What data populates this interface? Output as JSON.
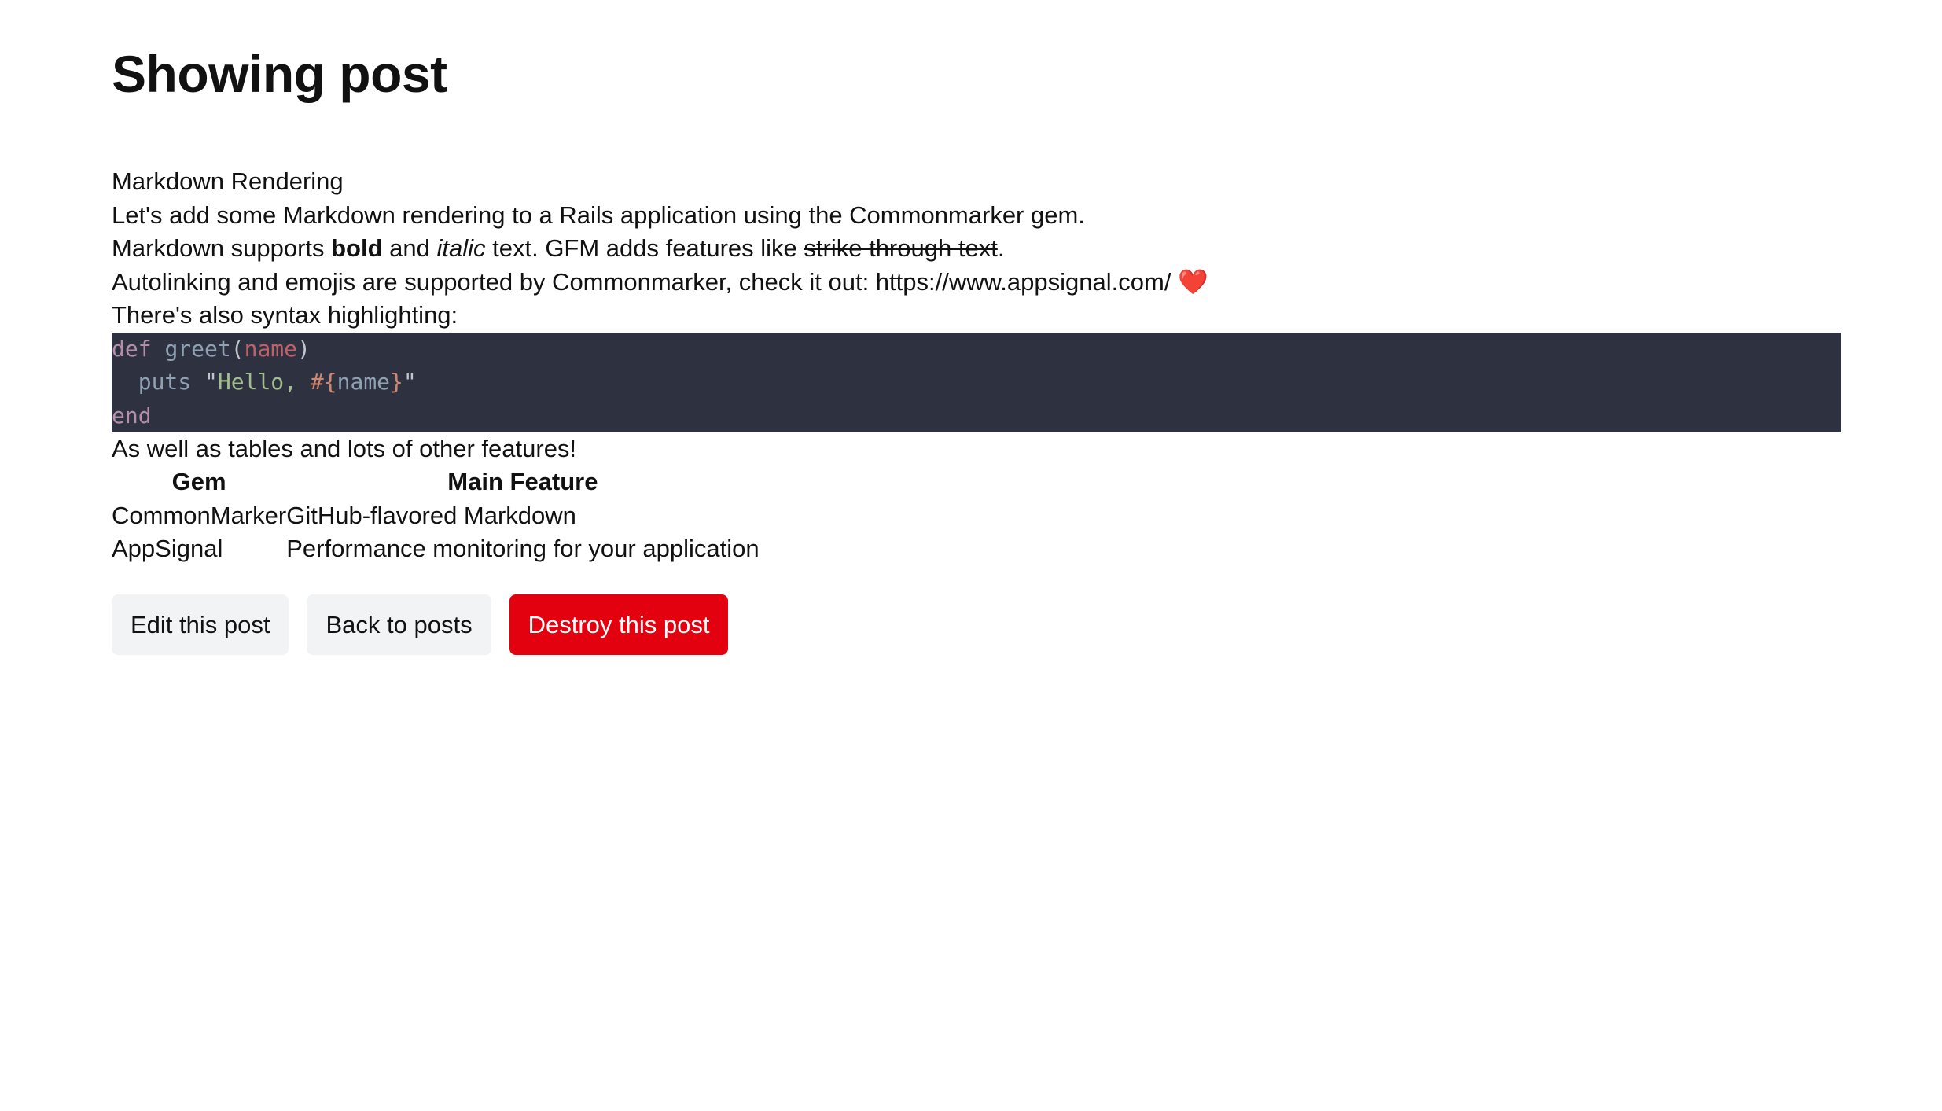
{
  "page": {
    "title": "Showing post"
  },
  "post": {
    "heading": "Markdown Rendering",
    "intro": "Let's add some Markdown rendering to a Rails application using the Commonmarker gem.",
    "line2": {
      "prefix": "Markdown supports ",
      "bold": "bold",
      "mid": " and ",
      "italic": "italic",
      "after": " text. GFM adds features like ",
      "strike": "strike through text",
      "end": "."
    },
    "line3": {
      "text": "Autolinking and emojis are supported by Commonmarker, check it out: https://www.appsignal.com/ ",
      "emoji": "❤️"
    },
    "line4": "There's also syntax highlighting:",
    "code": {
      "line1": {
        "kw": "def",
        "fn": "greet",
        "open": "(",
        "arg": "name",
        "close": ")"
      },
      "line2": {
        "indent": "  ",
        "fn": "puts",
        "q1": "\"",
        "str": "Hello, ",
        "itp_open": "#{",
        "var": "name",
        "itp_close": "}",
        "q2": "\""
      },
      "line3": {
        "kw": "end"
      }
    },
    "line5": "As well as tables and lots of other features!",
    "table": {
      "headers": [
        "Gem",
        "Main Feature"
      ],
      "rows": [
        [
          "CommonMarker",
          "GitHub-flavored Markdown"
        ],
        [
          "AppSignal",
          "Performance monitoring for your application"
        ]
      ]
    }
  },
  "actions": {
    "edit": "Edit this post",
    "back": "Back to posts",
    "destroy": "Destroy this post"
  },
  "colors": {
    "destroy_bg": "#e3000f",
    "code_bg": "#2e3240",
    "light_btn_bg": "#f2f3f5"
  }
}
